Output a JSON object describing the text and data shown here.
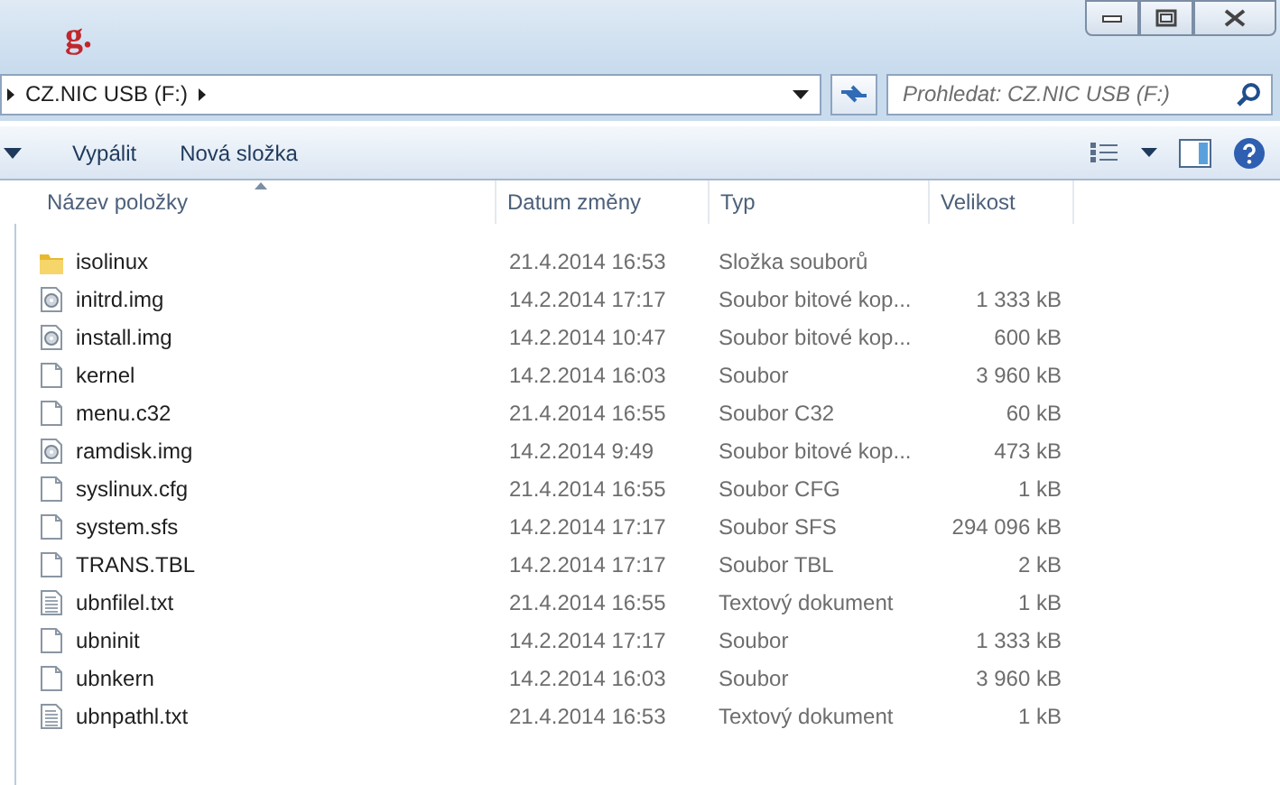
{
  "title_mark": "g.",
  "address": {
    "segments": [
      "CZ.NIC USB (F:)"
    ]
  },
  "search": {
    "placeholder": "Prohledat: CZ.NIC USB (F:)"
  },
  "toolbar": {
    "buttons": [
      "Vypálit",
      "Nová složka"
    ]
  },
  "columns": [
    "Název položky",
    "Datum změny",
    "Typ",
    "Velikost"
  ],
  "rows": [
    {
      "kind": "folder",
      "name": "isolinux",
      "date": "21.4.2014 16:53",
      "type": "Složka souborů",
      "size": ""
    },
    {
      "kind": "image",
      "name": "initrd.img",
      "date": "14.2.2014 17:17",
      "type": "Soubor bitové kop...",
      "size": "1 333 kB"
    },
    {
      "kind": "image",
      "name": "install.img",
      "date": "14.2.2014 10:47",
      "type": "Soubor bitové kop...",
      "size": "600 kB"
    },
    {
      "kind": "file",
      "name": "kernel",
      "date": "14.2.2014 16:03",
      "type": "Soubor",
      "size": "3 960 kB"
    },
    {
      "kind": "file",
      "name": "menu.c32",
      "date": "21.4.2014 16:55",
      "type": "Soubor C32",
      "size": "60 kB"
    },
    {
      "kind": "image",
      "name": "ramdisk.img",
      "date": "14.2.2014 9:49",
      "type": "Soubor bitové kop...",
      "size": "473 kB"
    },
    {
      "kind": "file",
      "name": "syslinux.cfg",
      "date": "21.4.2014 16:55",
      "type": "Soubor CFG",
      "size": "1 kB"
    },
    {
      "kind": "file",
      "name": "system.sfs",
      "date": "14.2.2014 17:17",
      "type": "Soubor SFS",
      "size": "294 096 kB"
    },
    {
      "kind": "file",
      "name": "TRANS.TBL",
      "date": "14.2.2014 17:17",
      "type": "Soubor TBL",
      "size": "2 kB"
    },
    {
      "kind": "text",
      "name": "ubnfilel.txt",
      "date": "21.4.2014 16:55",
      "type": "Textový dokument",
      "size": "1 kB"
    },
    {
      "kind": "file",
      "name": "ubninit",
      "date": "14.2.2014 17:17",
      "type": "Soubor",
      "size": "1 333 kB"
    },
    {
      "kind": "file",
      "name": "ubnkern",
      "date": "14.2.2014 16:03",
      "type": "Soubor",
      "size": "3 960 kB"
    },
    {
      "kind": "text",
      "name": "ubnpathl.txt",
      "date": "21.4.2014 16:53",
      "type": "Textový dokument",
      "size": "1 kB"
    }
  ]
}
